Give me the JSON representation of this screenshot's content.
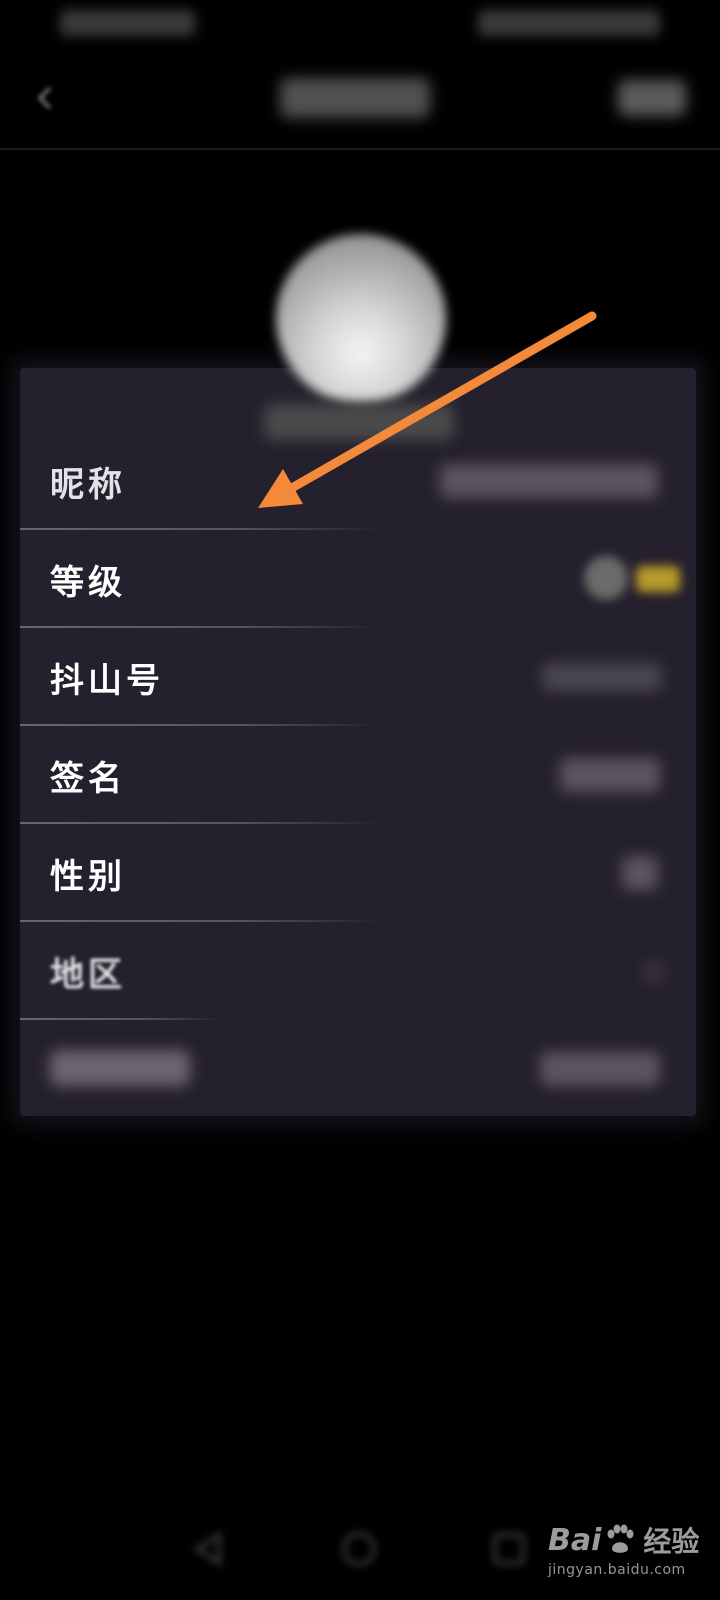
{
  "profile_fields": [
    {
      "label": "昵称"
    },
    {
      "label": "等级"
    },
    {
      "label": "抖山号"
    },
    {
      "label": "签名"
    },
    {
      "label": "性别"
    },
    {
      "label": "地区"
    }
  ],
  "icons": {
    "back": "chevron-left-icon",
    "nav_back": "triangle-back-icon",
    "nav_home": "circle-home-icon",
    "nav_recent": "square-recent-icon"
  },
  "colors": {
    "background": "#000000",
    "card": "#25202d",
    "annotation_arrow": "#f28a3a",
    "level_text": "#b89a2a"
  },
  "watermark": {
    "brand_left": "Bai",
    "brand_right": "经验",
    "url": "jingyan.baidu.com"
  }
}
